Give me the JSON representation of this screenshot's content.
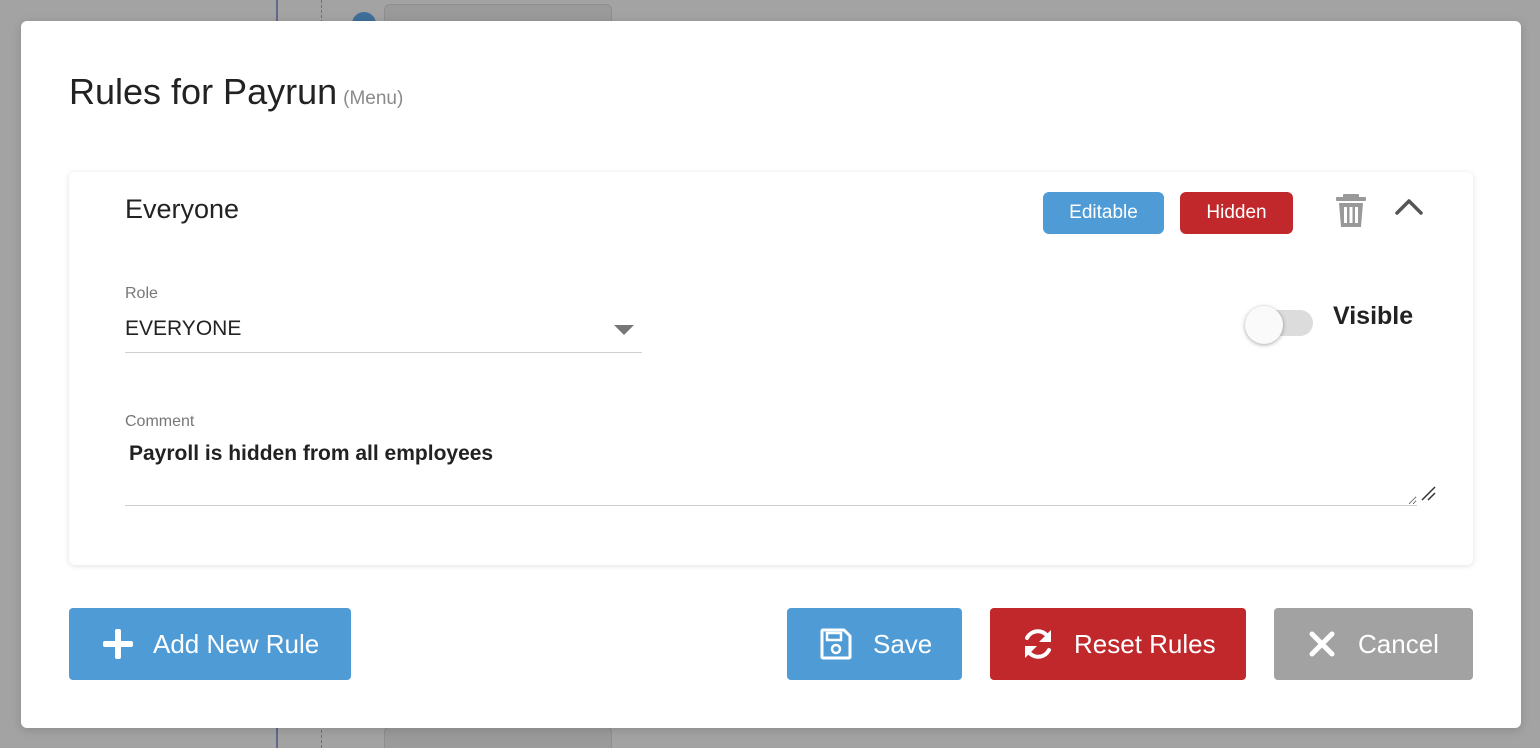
{
  "modal": {
    "title": "Rules for Payrun",
    "subtitle": "(Menu)"
  },
  "rule_card": {
    "title": "Everyone",
    "tags": {
      "editable": "Editable",
      "hidden": "Hidden"
    },
    "icons": {
      "delete": "trash-icon",
      "collapse": "chevron-up-icon"
    },
    "role": {
      "label": "Role",
      "value": "EVERYONE"
    },
    "visibility_toggle": {
      "label": "Visible",
      "checked": false
    },
    "comment": {
      "label": "Comment",
      "value": "Payroll is hidden from all employees"
    }
  },
  "actions": {
    "add_label": "Add New Rule",
    "save_label": "Save",
    "reset_label": "Reset Rules",
    "cancel_label": "Cancel"
  },
  "colors": {
    "primary": "#4f9bd6",
    "danger": "#c0282b",
    "neutral": "#a2a2a2"
  }
}
